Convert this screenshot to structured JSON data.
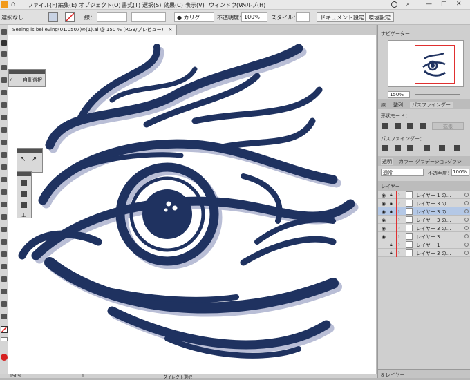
{
  "menubar": {
    "items": [
      "ファイル(F)",
      "編集(E)",
      "オブジェクト(O)",
      "書式(T)",
      "選択(S)",
      "効果(C)",
      "表示(V)",
      "ウィンドウ(W)",
      "ヘルプ(H)"
    ]
  },
  "control_bar": {
    "selection_label": "選択なし",
    "stroke_label": "線：",
    "brush_value": "カリグ…",
    "opacity_label": "不透明度：",
    "opacity_value": "100%",
    "style_label": "スタイル：",
    "doc_settings": "ドキュメント設定",
    "preferences": "環境設定"
  },
  "document": {
    "tab_title": "Seeing is believing(01.0507)※(1).ai @ 150 % (RGB/プレビュー)",
    "close": "×"
  },
  "flyout": {
    "auto_select": "自動選択"
  },
  "status": {
    "zoom": "150%",
    "page": "1",
    "tool": "ダイレクト選択"
  },
  "navigator": {
    "title": "ナビゲーター",
    "zoom": "150%"
  },
  "pathfinder": {
    "tabs": [
      "線",
      "整列",
      "パスファインダー"
    ],
    "shape_modes_label": "形状モード：",
    "expand": "拡張",
    "pathfinders_label": "パスファインダー："
  },
  "transparency": {
    "tabs": [
      "透明",
      "カラー",
      "グラデーション",
      "ブラシ"
    ],
    "blend_mode": "通常",
    "opacity_label": "不透明度：",
    "opacity_value": "100%"
  },
  "layers": {
    "title": "レイヤー",
    "rows": [
      {
        "name": "レイヤー 1 の…",
        "eye": true,
        "locked": true,
        "selected": false
      },
      {
        "name": "レイヤー 3 の…",
        "eye": true,
        "locked": true,
        "selected": false
      },
      {
        "name": "レイヤー 3 の…",
        "eye": true,
        "locked": true,
        "selected": true
      },
      {
        "name": "レイヤー 3 の…",
        "eye": true,
        "locked": false,
        "selected": false
      },
      {
        "name": "レイヤー 3 の…",
        "eye": true,
        "locked": false,
        "selected": false
      },
      {
        "name": "レイヤー 3",
        "eye": true,
        "locked": false,
        "selected": false
      },
      {
        "name": "レイヤー 1",
        "eye": false,
        "locked": true,
        "selected": false
      },
      {
        "name": "レイヤー 3 の…",
        "eye": false,
        "locked": true,
        "selected": false
      }
    ],
    "count": "8 レイヤー"
  },
  "colors": {
    "artwork": "#1f3260",
    "shadow": "#b9bed6",
    "selection": "#b4c8e6",
    "layer_color": "#e03030"
  },
  "icons": [
    "home-icon",
    "fill-swatch-icon",
    "stroke-swatch-icon",
    "user-icon",
    "search-icon",
    "eye-icon",
    "lock-icon",
    "chevron-right-icon"
  ]
}
